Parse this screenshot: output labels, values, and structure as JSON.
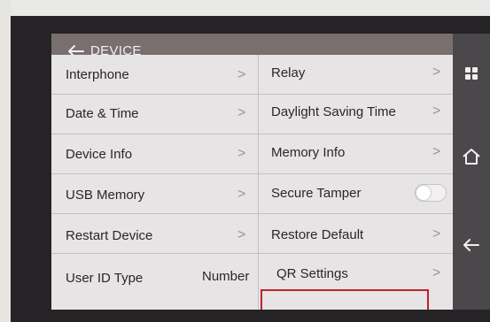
{
  "header": {
    "title": "DEVICE",
    "back_icon": "arrow-left-icon"
  },
  "left_column": [
    {
      "label": "Interphone",
      "chevron": ">"
    },
    {
      "label": "Date & Time",
      "chevron": ">"
    },
    {
      "label": "Device Info",
      "chevron": ">"
    },
    {
      "label": "USB Memory",
      "chevron": ">"
    },
    {
      "label": "Restart Device",
      "chevron": ">"
    },
    {
      "label": "User ID Type",
      "value": "Number"
    }
  ],
  "right_column": [
    {
      "label": "Relay",
      "chevron": ">"
    },
    {
      "label": "Daylight Saving Time",
      "chevron": ">"
    },
    {
      "label": "Memory Info",
      "chevron": ">"
    },
    {
      "label": "Secure Tamper",
      "toggle": "off"
    },
    {
      "label": "Restore Default",
      "chevron": ">"
    },
    {
      "label": "QR Settings",
      "chevron": ">",
      "highlighted": true
    }
  ],
  "sidebar": {
    "icons": [
      "apps-grid-icon",
      "home-icon",
      "back-arrow-icon"
    ]
  },
  "colors": {
    "title_bar": "#7a6f6f",
    "cell_background": "#e6e4e5",
    "highlight_border": "#c0222a",
    "sidebar": "#4a484b"
  }
}
